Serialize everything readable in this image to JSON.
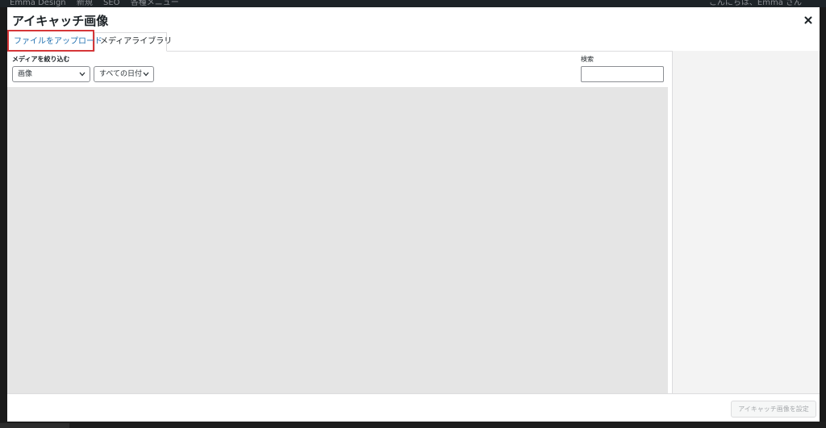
{
  "admin_bar": {
    "site_name": "Emma Design",
    "new_label": "新規",
    "seo_label": "SEO",
    "menu_label": "各種メニュー",
    "greeting": "こんにちは、Emma さん"
  },
  "modal": {
    "title": "アイキャッチ画像",
    "close_icon": "close-icon"
  },
  "tabs": [
    {
      "label": "ファイルをアップロード",
      "highlighted": true,
      "highlight_color": "#d63638"
    },
    {
      "label": "メディアライブラリ",
      "active": true
    }
  ],
  "toolbar": {
    "filter_label": "メディアを絞り込む",
    "type_select": {
      "value": "画像"
    },
    "date_select": {
      "value": "すべての日付"
    },
    "search_label": "検索",
    "search_value": ""
  },
  "footer": {
    "set_button_label": "アイキャッチ画像を設定"
  },
  "colors": {
    "link_blue": "#2271b1",
    "highlight_red": "#d63638",
    "grid_bg": "#e5e5e5",
    "sidebar_bg": "#f3f3f3"
  }
}
